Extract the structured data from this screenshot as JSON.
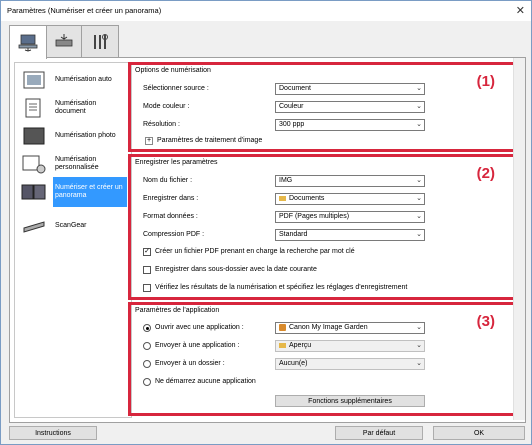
{
  "window": {
    "title": "Paramètres (Numériser et créer un panorama)",
    "close": "✕"
  },
  "tabs": [
    {
      "name": "scan-tab",
      "icon": "scanner-computer-icon"
    },
    {
      "name": "scanner-tab",
      "icon": "scanner-icon"
    },
    {
      "name": "tools-tab",
      "icon": "tools-icon"
    }
  ],
  "sidebar": {
    "items": [
      {
        "label": "Numérisation auto"
      },
      {
        "label": "Numérisation document"
      },
      {
        "label": "Numérisation photo"
      },
      {
        "label": "Numérisation personnalisée"
      },
      {
        "label": "Numériser et créer un panorama",
        "selected": true
      },
      {
        "label": "ScanGear"
      }
    ]
  },
  "scan_options": {
    "title": "Options de numérisation",
    "number": "(1)",
    "source_label": "Sélectionner source :",
    "source_value": "Document",
    "color_label": "Mode couleur :",
    "color_value": "Couleur",
    "resolution_label": "Résolution :",
    "resolution_value": "300 ppp",
    "image_settings_label": "Paramètres de traitement d'image"
  },
  "save_settings": {
    "title": "Enregistrer les paramètres",
    "number": "(2)",
    "filename_label": "Nom du fichier :",
    "filename_value": "IMG",
    "save_in_label": "Enregistrer dans :",
    "save_in_value": "Documents",
    "format_label": "Format données :",
    "format_value": "PDF (Pages multiples)",
    "compression_label": "Compression PDF :",
    "compression_value": "Standard",
    "cb_keyword": "Créer un fichier PDF prenant en charge la recherche par mot clé",
    "cb_subfolder": "Enregistrer dans sous-dossier avec la date courante",
    "cb_verify": "Vérifiez les résultats de la numérisation et spécifiez les réglages d'enregistrement"
  },
  "app_settings": {
    "title": "Paramètres de l'application",
    "number": "(3)",
    "open_app_label": "Ouvrir avec une application :",
    "open_app_value": "Canon My Image Garden",
    "send_app_label": "Envoyer à une application :",
    "send_app_value": "Aperçu",
    "send_folder_label": "Envoyer à un dossier :",
    "send_folder_value": "Aucun(e)",
    "no_app_label": "Ne démarrez aucune application",
    "more_functions": "Fonctions supplémentaires"
  },
  "footer": {
    "instructions": "Instructions",
    "defaults": "Par défaut",
    "ok": "OK"
  },
  "colors": {
    "highlight": "#d7263d",
    "selection": "#3399ff"
  }
}
